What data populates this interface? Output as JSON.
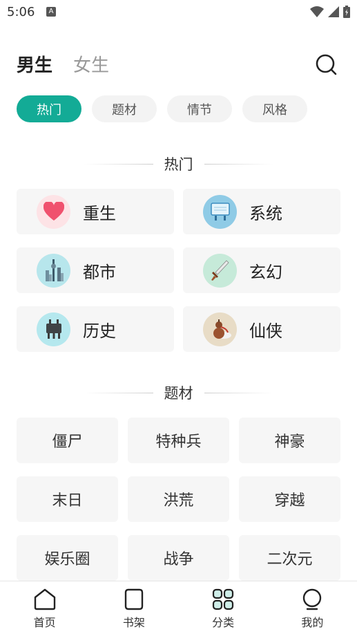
{
  "status": {
    "time": "5:06"
  },
  "header": {
    "tabs": [
      {
        "label": "男生",
        "active": true
      },
      {
        "label": "女生",
        "active": false
      }
    ]
  },
  "filters": [
    {
      "label": "热门",
      "active": true
    },
    {
      "label": "题材",
      "active": false
    },
    {
      "label": "情节",
      "active": false
    },
    {
      "label": "风格",
      "active": false
    }
  ],
  "hot_section": {
    "title": "热门",
    "items": [
      {
        "label": "重生",
        "icon": "heart-icon"
      },
      {
        "label": "系统",
        "icon": "screen-icon"
      },
      {
        "label": "都市",
        "icon": "city-icon"
      },
      {
        "label": "玄幻",
        "icon": "sword-icon"
      },
      {
        "label": "历史",
        "icon": "bronze-vessel-icon"
      },
      {
        "label": "仙侠",
        "icon": "gourd-icon"
      }
    ]
  },
  "topic_section": {
    "title": "题材",
    "items": [
      "僵尸",
      "特种兵",
      "神豪",
      "末日",
      "洪荒",
      "穿越",
      "娱乐圈",
      "战争",
      "二次元"
    ]
  },
  "bottom_nav": [
    {
      "label": "首页",
      "icon": "home-icon",
      "active": false
    },
    {
      "label": "书架",
      "icon": "bookshelf-icon",
      "active": false
    },
    {
      "label": "分类",
      "icon": "category-icon",
      "active": true
    },
    {
      "label": "我的",
      "icon": "profile-icon",
      "active": false
    }
  ],
  "colors": {
    "accent": "#13ab96"
  }
}
